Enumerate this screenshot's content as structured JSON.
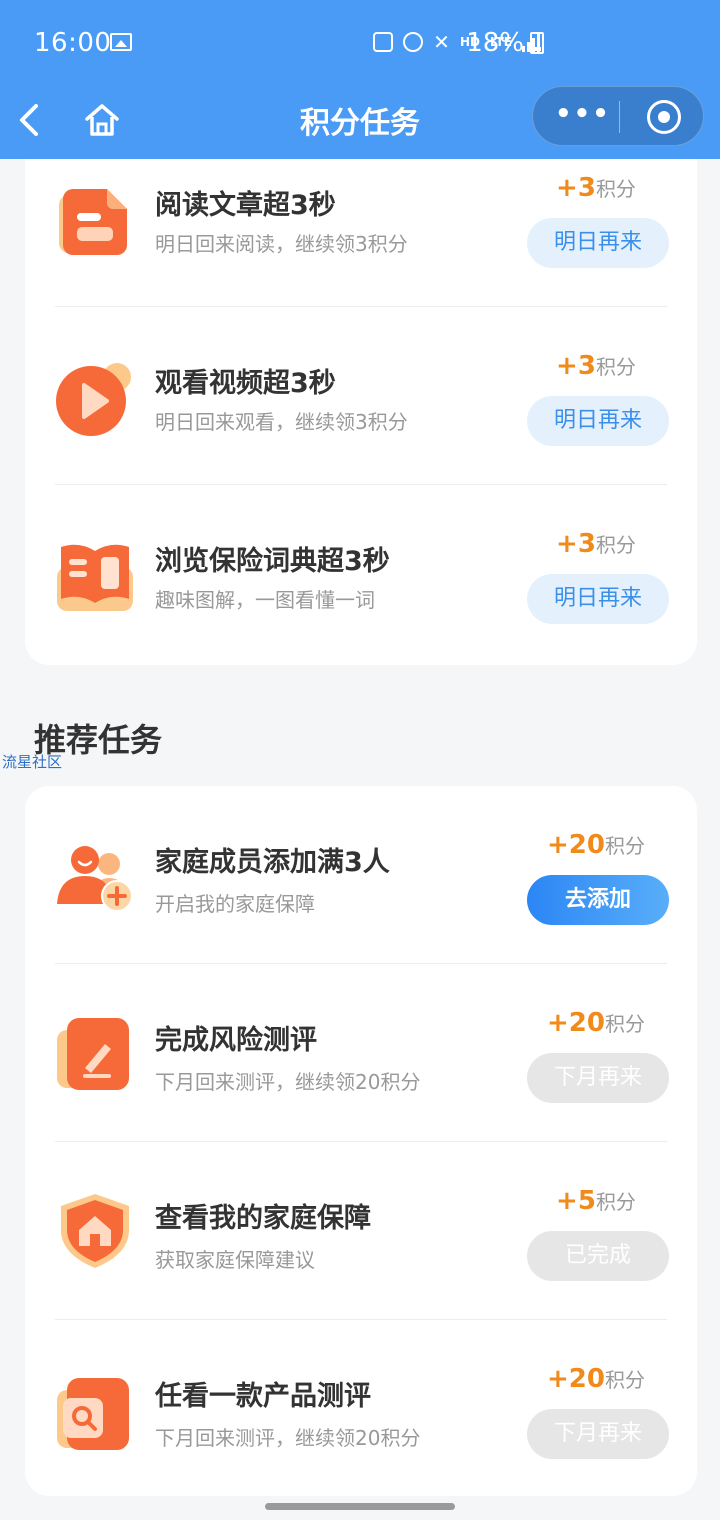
{
  "status": {
    "time": "16:00",
    "network": "HD",
    "lte": "LTE",
    "battery": "18%"
  },
  "nav": {
    "title": "积分任务",
    "more_icon": "•••"
  },
  "daily_tasks": [
    {
      "title": "阅读文章超3秒",
      "desc": "明日回来阅读，继续领3积分",
      "points": "+3",
      "unit": "积分",
      "button": "明日再来",
      "icon": "document-icon"
    },
    {
      "title": "观看视频超3秒",
      "desc": "明日回来观看，继续领3积分",
      "points": "+3",
      "unit": "积分",
      "button": "明日再来",
      "icon": "video-play-icon"
    },
    {
      "title": "浏览保险词典超3秒",
      "desc": "趣味图解，一图看懂一词",
      "points": "+3",
      "unit": "积分",
      "button": "明日再来",
      "icon": "book-icon"
    }
  ],
  "recommended": {
    "title": "推荐任务",
    "watermark": "流星社区",
    "tasks": [
      {
        "title": "家庭成员添加满3人",
        "desc": "开启我的家庭保障",
        "points": "+20",
        "unit": "积分",
        "button": "去添加",
        "icon": "add-family-icon"
      },
      {
        "title": "完成风险测评",
        "desc": "下月回来测评，继续领20积分",
        "points": "+20",
        "unit": "积分",
        "button": "下月再来",
        "icon": "edit-assessment-icon"
      },
      {
        "title": "查看我的家庭保障",
        "desc": "获取家庭保障建议",
        "points": "+5",
        "unit": "积分",
        "button": "已完成",
        "icon": "shield-home-icon"
      },
      {
        "title": "任看一款产品测评",
        "desc": "下月回来测评，继续领20积分",
        "points": "+20",
        "unit": "积分",
        "button": "下月再来",
        "icon": "search-review-icon"
      }
    ]
  }
}
